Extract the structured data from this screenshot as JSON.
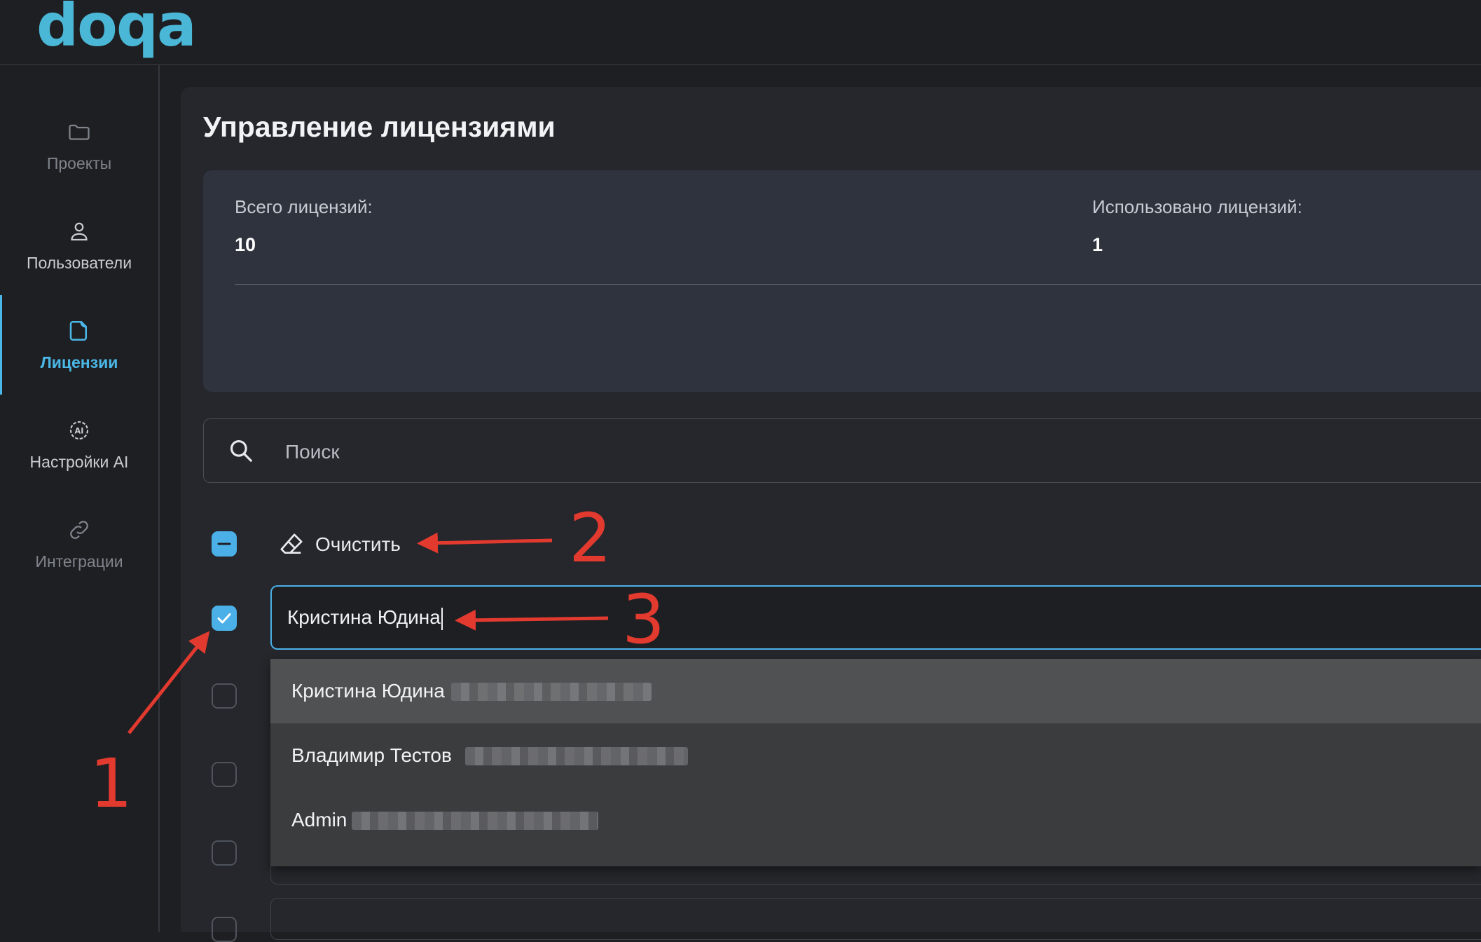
{
  "brand": {
    "logo_text": "doqa",
    "accent_color": "#4bb7d6"
  },
  "sidebar": {
    "items": [
      {
        "label": "Проекты",
        "icon": "folder-icon",
        "state": "dim"
      },
      {
        "label": "Пользователи",
        "icon": "user-icon",
        "state": "normal"
      },
      {
        "label": "Лицензии",
        "icon": "license-icon",
        "state": "active"
      },
      {
        "label": "Настройки AI",
        "icon": "ai-icon",
        "state": "normal"
      },
      {
        "label": "Интеграции",
        "icon": "link-icon",
        "state": "dim"
      }
    ]
  },
  "page": {
    "title": "Управление лицензиями"
  },
  "stats": {
    "total_label": "Всего лицензий:",
    "total_value": "10",
    "used_label": "Использовано лицензий:",
    "used_value": "1"
  },
  "search": {
    "placeholder": "Поиск",
    "icon": "search-icon"
  },
  "toolbar": {
    "clear_label": "Очистить",
    "clear_icon": "eraser-icon"
  },
  "license_rows": [
    {
      "value": "Кристина Юдина",
      "checked": true,
      "focused": true
    }
  ],
  "dropdown": {
    "options": [
      {
        "name": "Кристина Юдина",
        "highlighted": true
      },
      {
        "name": "Владимир Тестов",
        "highlighted": false
      },
      {
        "name": "Admin",
        "highlighted": false
      }
    ]
  },
  "annotations": {
    "one": "1",
    "two": "2",
    "three": "3",
    "color": "#e23a2f"
  }
}
